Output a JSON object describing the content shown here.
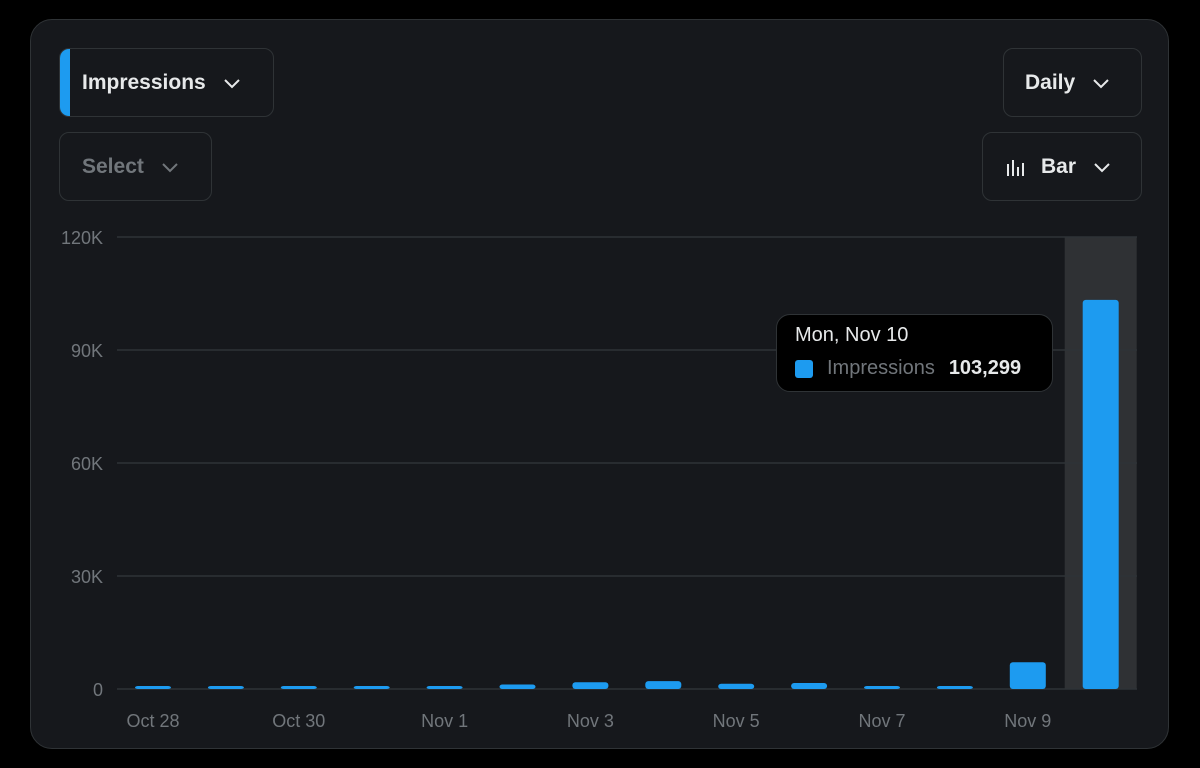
{
  "controls": {
    "metric_label": "Impressions",
    "compare_label": "Select",
    "interval_label": "Daily",
    "chart_type_label": "Bar",
    "accent_color": "#1d9bf0"
  },
  "tooltip": {
    "date": "Mon, Nov 10",
    "series": "Impressions",
    "value": "103,299"
  },
  "chart_data": {
    "type": "bar",
    "categories": [
      "Oct 28",
      "Oct 29",
      "Oct 30",
      "Oct 31",
      "Nov 1",
      "Nov 2",
      "Nov 3",
      "Nov 4",
      "Nov 5",
      "Nov 6",
      "Nov 7",
      "Nov 8",
      "Nov 9",
      "Nov 10"
    ],
    "x_tick_labels": [
      "Oct 28",
      "Oct 30",
      "Nov 1",
      "Nov 3",
      "Nov 5",
      "Nov 7",
      "Nov 9"
    ],
    "series": [
      {
        "name": "Impressions",
        "values": [
          300,
          400,
          350,
          350,
          450,
          1200,
          1800,
          2100,
          1400,
          1600,
          750,
          500,
          7100,
          103299
        ],
        "color": "#1d9bf0"
      }
    ],
    "ylim": [
      0,
      120000
    ],
    "y_tick_labels": [
      "0",
      "30K",
      "60K",
      "90K",
      "120K"
    ],
    "y_ticks": [
      0,
      30000,
      60000,
      90000,
      120000
    ],
    "highlighted_category": "Nov 10",
    "grid": true
  }
}
